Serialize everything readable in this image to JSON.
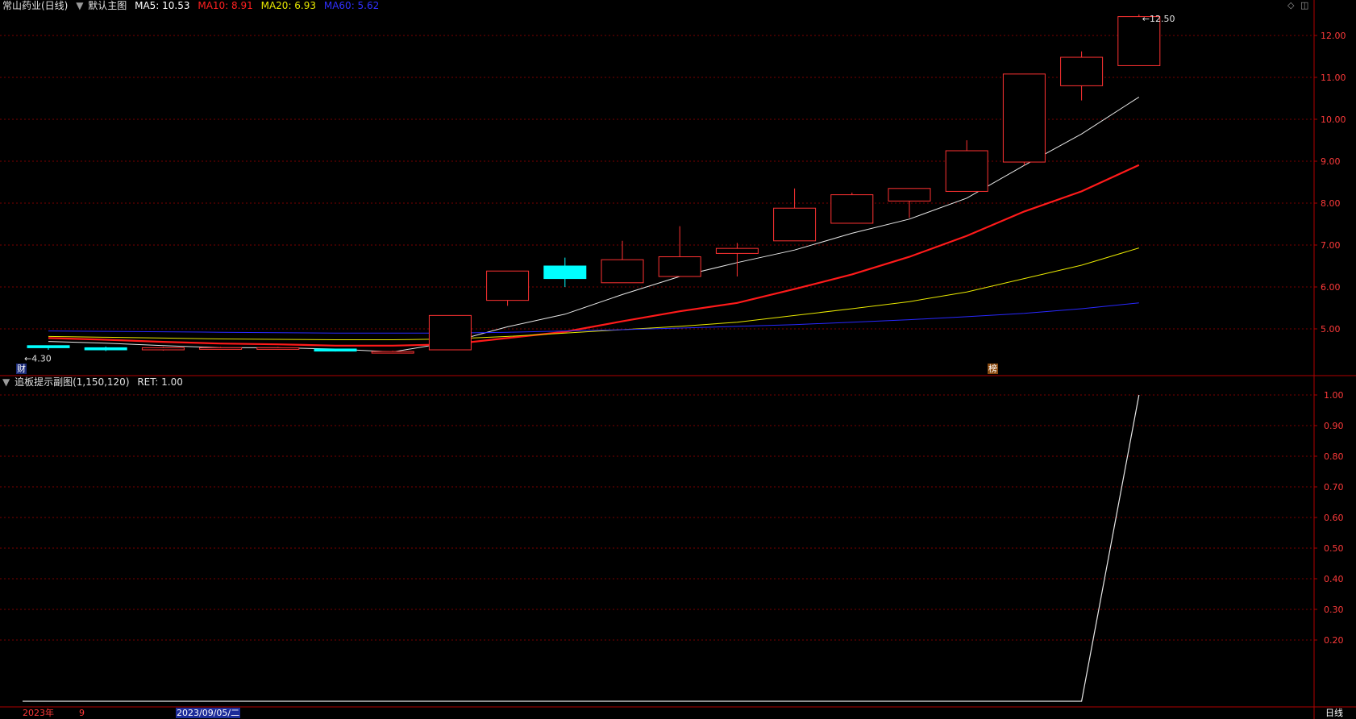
{
  "header": {
    "stock_title": "常山药业(日线)",
    "template_label": "默认主图",
    "indicators": [
      {
        "label": "MA5: 10.53",
        "color": "#ffffff"
      },
      {
        "label": "MA10: 8.91",
        "color": "#ff2020"
      },
      {
        "label": "MA20: 6.93",
        "color": "#e8e800"
      },
      {
        "label": "MA60: 5.62",
        "color": "#2020ff"
      }
    ]
  },
  "sub_header": {
    "title": "追板提示副图(1,150,120)",
    "value_label": "RET: 1.00"
  },
  "footer": {
    "year_label": "2023年",
    "month_label": "9",
    "date_label": "2023/09/05/二",
    "period_label": "日线"
  },
  "markers": {
    "fin_tag": "财",
    "rank_tag": "榜"
  },
  "colors": {
    "up": "#ff3232",
    "down": "#00ffff",
    "axis": "#b00000",
    "grid": "#7a0000",
    "tick_text": "#ff3a3a"
  },
  "chart_data": [
    {
      "type": "candlestick",
      "title": "常山药业(日线)",
      "ylim": [
        4.0,
        12.8
      ],
      "y_ticks": [
        "5.00",
        "6.00",
        "7.00",
        "8.00",
        "9.00",
        "10.00",
        "11.00",
        "12.00"
      ],
      "low_annotation": "4.30",
      "high_annotation": "12.50",
      "candles": [
        {
          "open": 4.6,
          "close": 4.55,
          "high": 4.6,
          "low": 4.5
        },
        {
          "open": 4.55,
          "close": 4.5,
          "high": 4.58,
          "low": 4.47
        },
        {
          "open": 4.5,
          "close": 4.55,
          "high": 4.57,
          "low": 4.48
        },
        {
          "open": 4.55,
          "close": 4.55,
          "high": 4.57,
          "low": 4.52
        },
        {
          "open": 4.55,
          "close": 4.55,
          "high": 4.57,
          "low": 4.52
        },
        {
          "open": 4.52,
          "close": 4.47,
          "high": 4.53,
          "low": 4.46
        },
        {
          "open": 4.46,
          "close": 4.46,
          "high": 4.48,
          "low": 4.44
        },
        {
          "open": 4.5,
          "close": 5.32,
          "high": 5.32,
          "low": 4.5
        },
        {
          "open": 5.68,
          "close": 6.38,
          "high": 6.38,
          "low": 5.55
        },
        {
          "open": 6.5,
          "close": 6.2,
          "high": 6.7,
          "low": 6.0
        },
        {
          "open": 6.1,
          "close": 6.65,
          "high": 7.1,
          "low": 6.1
        },
        {
          "open": 6.25,
          "close": 6.72,
          "high": 7.45,
          "low": 6.25
        },
        {
          "open": 6.8,
          "close": 6.92,
          "high": 7.05,
          "low": 6.25
        },
        {
          "open": 7.1,
          "close": 7.88,
          "high": 8.35,
          "low": 7.1
        },
        {
          "open": 7.52,
          "close": 8.2,
          "high": 8.25,
          "low": 7.52
        },
        {
          "open": 8.05,
          "close": 8.35,
          "high": 8.35,
          "low": 7.65
        },
        {
          "open": 8.28,
          "close": 9.25,
          "high": 9.5,
          "low": 8.28
        },
        {
          "open": 8.98,
          "close": 11.08,
          "high": 11.08,
          "low": 8.9
        },
        {
          "open": 10.8,
          "close": 11.48,
          "high": 11.62,
          "low": 10.45
        },
        {
          "open": 11.28,
          "close": 12.45,
          "high": 12.5,
          "low": 11.28
        }
      ],
      "series": [
        {
          "name": "MA5",
          "color": "#e8e8e8",
          "width": 1,
          "values": [
            4.7,
            4.66,
            4.6,
            4.55,
            4.55,
            4.52,
            4.45,
            4.68,
            5.05,
            5.35,
            5.82,
            6.25,
            6.58,
            6.88,
            7.28,
            7.62,
            8.12,
            8.9,
            9.65,
            10.53
          ]
        },
        {
          "name": "MA10",
          "color": "#ff1a1a",
          "width": 2.2,
          "values": [
            4.78,
            4.74,
            4.69,
            4.65,
            4.63,
            4.6,
            4.6,
            4.63,
            4.78,
            4.93,
            5.18,
            5.42,
            5.62,
            5.95,
            6.3,
            6.72,
            7.22,
            7.8,
            8.28,
            8.91
          ]
        },
        {
          "name": "MA20",
          "color": "#e8e800",
          "width": 1,
          "values": [
            4.82,
            4.8,
            4.78,
            4.76,
            4.75,
            4.74,
            4.74,
            4.76,
            4.82,
            4.9,
            4.98,
            5.06,
            5.16,
            5.32,
            5.48,
            5.65,
            5.88,
            6.2,
            6.52,
            6.93
          ]
        },
        {
          "name": "MA60",
          "color": "#2828ff",
          "width": 1,
          "values": [
            4.95,
            4.94,
            4.93,
            4.92,
            4.91,
            4.9,
            4.9,
            4.9,
            4.92,
            4.95,
            4.98,
            5.02,
            5.06,
            5.1,
            5.16,
            5.22,
            5.29,
            5.37,
            5.48,
            5.62
          ]
        }
      ]
    },
    {
      "type": "line",
      "title": "追板提示副图(1,150,120)",
      "ylim": [
        0,
        1.05
      ],
      "y_ticks": [
        "0.20",
        "0.30",
        "0.40",
        "0.50",
        "0.60",
        "0.70",
        "0.80",
        "0.90",
        "1.00"
      ],
      "series": [
        {
          "name": "RET",
          "color": "#e8e8e8",
          "values": [
            0,
            0,
            0,
            0,
            0,
            0,
            0,
            0,
            0,
            0,
            0,
            0,
            0,
            0,
            0,
            0,
            0,
            0,
            0,
            1.0
          ]
        }
      ]
    }
  ]
}
